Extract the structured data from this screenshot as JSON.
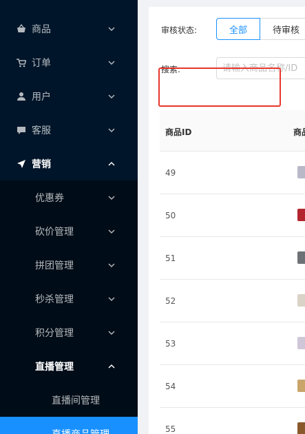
{
  "sidebar": {
    "menu": [
      {
        "label": "商品",
        "icon": "basket-icon",
        "name": "menu-products"
      },
      {
        "label": "订单",
        "icon": "cart-icon",
        "name": "menu-orders"
      },
      {
        "label": "用户",
        "icon": "user-icon",
        "name": "menu-users"
      },
      {
        "label": "客服",
        "icon": "chat-icon",
        "name": "menu-service"
      },
      {
        "label": "营销",
        "icon": "send-icon",
        "name": "menu-marketing"
      }
    ],
    "marketing_sub": [
      {
        "label": "优惠券",
        "name": "submenu-coupon"
      },
      {
        "label": "砍价管理",
        "name": "submenu-bargain"
      },
      {
        "label": "拼团管理",
        "name": "submenu-group-buy"
      },
      {
        "label": "秒杀管理",
        "name": "submenu-flash-sale"
      },
      {
        "label": "积分管理",
        "name": "submenu-points"
      },
      {
        "label": "直播管理",
        "name": "submenu-live"
      }
    ],
    "live_children": [
      {
        "label": "直播间管理",
        "name": "live-room-management"
      },
      {
        "label": "直播商品管理",
        "name": "live-product-management"
      }
    ]
  },
  "filters": {
    "status_label": "审核状态:",
    "status_options": [
      "全部",
      "待审核"
    ],
    "search_label": "搜索:",
    "search_placeholder": "请输入商品名称/ID"
  },
  "table": {
    "columns": [
      "商品ID",
      "商品"
    ],
    "rows": [
      {
        "id": "49",
        "thumb": "#b8b8c8"
      },
      {
        "id": "50",
        "thumb": "#b3262e"
      },
      {
        "id": "51",
        "thumb": "#6e7276"
      },
      {
        "id": "52",
        "thumb": "#d9d2c6"
      },
      {
        "id": "53",
        "thumb": "#cfc6d8"
      },
      {
        "id": "54",
        "thumb": "#c9a56b"
      },
      {
        "id": "55",
        "thumb": "#8a5a2c"
      }
    ]
  }
}
